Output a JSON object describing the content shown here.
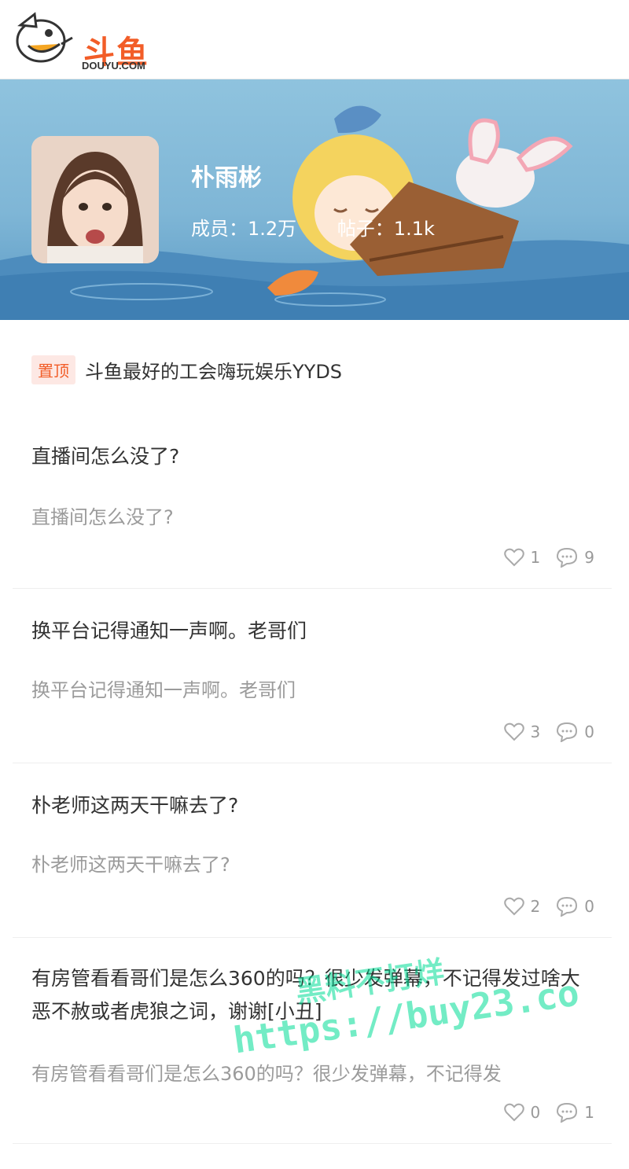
{
  "header": {
    "logo_text": "斗鱼",
    "logo_sub": "DOUYU.COM"
  },
  "group": {
    "name": "朴雨彬",
    "members_label": "成员：1.2万",
    "posts_label": "帖子：1.1k"
  },
  "pinned": {
    "badge": "置顶",
    "title": "斗鱼最好的工会嗨玩娱乐YYDS"
  },
  "posts": [
    {
      "title": "直播间怎么没了?",
      "body": "直播间怎么没了?",
      "likes": "1",
      "comments": "9"
    },
    {
      "title": "换平台记得通知一声啊。老哥们",
      "body": "换平台记得通知一声啊。老哥们",
      "likes": "3",
      "comments": "0"
    },
    {
      "title": "朴老师这两天干嘛去了?",
      "body": "朴老师这两天干嘛去了?",
      "likes": "2",
      "comments": "0"
    },
    {
      "title": "有房管看看哥们是怎么360的吗？很少发弹幕，不记得发过啥大恶不赦或者虎狼之词，谢谢[小丑]",
      "body": "有房管看看哥们是怎么360的吗？很少发弹幕，不记得发",
      "likes": "0",
      "comments": "1"
    }
  ],
  "watermark": {
    "line1": "黑料不打烊",
    "line2": "https://buy23.co"
  },
  "colors": {
    "brand": "#f25d28",
    "banner": "#7fb6d6",
    "muted": "#9b9b9b"
  },
  "icons": [
    "heart-icon",
    "comment-icon"
  ]
}
